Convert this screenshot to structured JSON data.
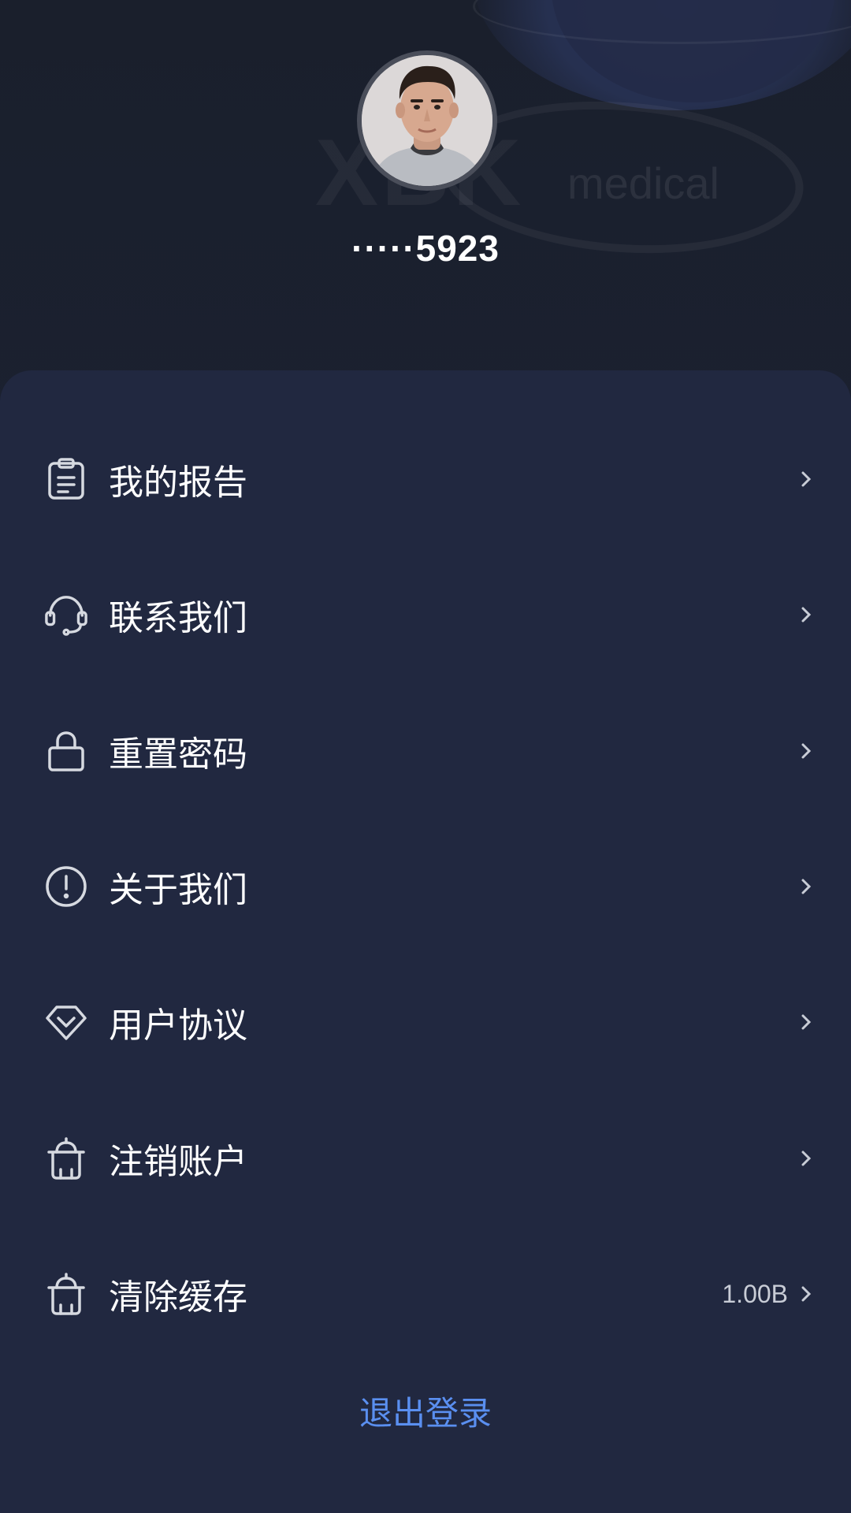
{
  "profile": {
    "username": "·····5923",
    "avatar_icon": "user-avatar-photo"
  },
  "watermark": {
    "brand": "XBK",
    "sub": "medical"
  },
  "menu": {
    "items": [
      {
        "label": "我的报告",
        "icon": "clipboard-icon",
        "value": ""
      },
      {
        "label": "联系我们",
        "icon": "headset-icon",
        "value": ""
      },
      {
        "label": "重置密码",
        "icon": "lock-icon",
        "value": ""
      },
      {
        "label": "关于我们",
        "icon": "info-circle-icon",
        "value": ""
      },
      {
        "label": "用户协议",
        "icon": "diamond-icon",
        "value": ""
      },
      {
        "label": "注销账户",
        "icon": "trash-icon",
        "value": ""
      },
      {
        "label": "清除缓存",
        "icon": "trash-icon",
        "value": "1.00B"
      }
    ]
  },
  "logout_label": "退出登录",
  "colors": {
    "background": "#1b2030",
    "card": "#212840",
    "text": "#ffffff",
    "icon": "#d6d9e0",
    "accent_link": "#5a8ff0"
  }
}
